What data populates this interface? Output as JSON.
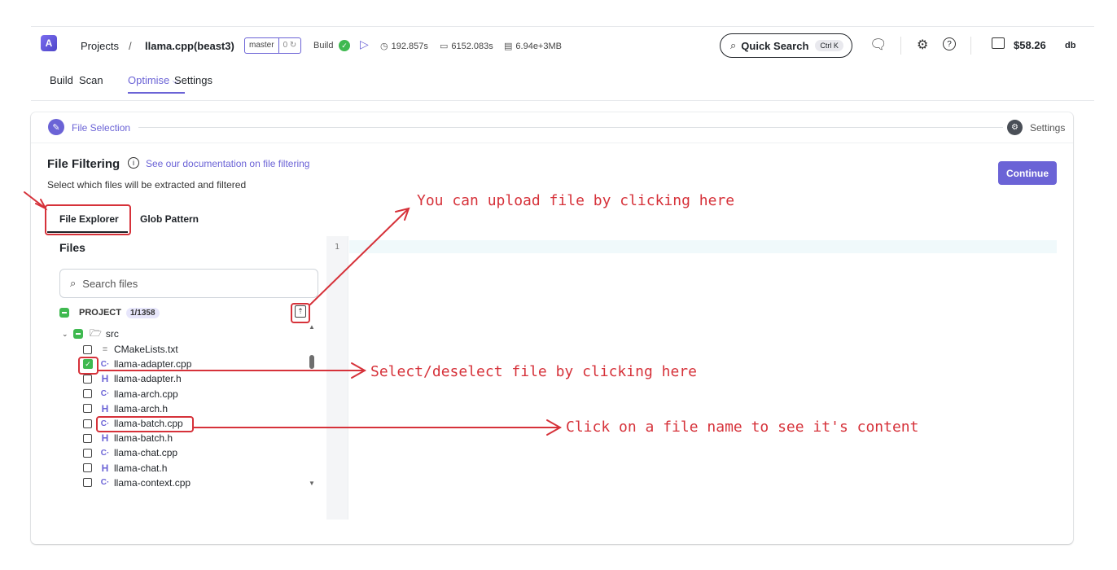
{
  "header": {
    "breadcrumb_projects": "Projects",
    "breadcrumb_sep": "/",
    "project_name": "llama.cpp(beast3)",
    "branch": "master",
    "branch_count": "0 ↻",
    "build_label": "Build",
    "stat_time": "192.857s",
    "stat_cpu": "6152.083s",
    "stat_mem": "6.94e+3MB",
    "quick_search": "Quick Search",
    "quick_search_kbd": "Ctrl K",
    "balance": "$58.26",
    "user": "db"
  },
  "nav": {
    "build": "Build",
    "scan": "Scan",
    "optimise": "Optimise",
    "settings": "Settings"
  },
  "stepper": {
    "step1": "File Selection",
    "step2": "Settings"
  },
  "filtering": {
    "title": "File Filtering",
    "doc_link": "See our documentation on file filtering",
    "subtitle": "Select which files will be extracted and filtered",
    "continue": "Continue",
    "tabs": [
      "File Explorer",
      "Glob Pattern"
    ]
  },
  "files": {
    "heading": "Files",
    "search_placeholder": "Search files",
    "project_label": "PROJECT",
    "project_count": "1/1358",
    "folder": "src",
    "items": [
      {
        "name": "CMakeLists.txt",
        "icon": "text",
        "checked": false
      },
      {
        "name": "llama-adapter.cpp",
        "icon": "cpp",
        "checked": true
      },
      {
        "name": "llama-adapter.h",
        "icon": "h",
        "checked": false
      },
      {
        "name": "llama-arch.cpp",
        "icon": "cpp",
        "checked": false
      },
      {
        "name": "llama-arch.h",
        "icon": "h",
        "checked": false
      },
      {
        "name": "llama-batch.cpp",
        "icon": "cpp",
        "checked": false
      },
      {
        "name": "llama-batch.h",
        "icon": "h",
        "checked": false
      },
      {
        "name": "llama-chat.cpp",
        "icon": "cpp",
        "checked": false
      },
      {
        "name": "llama-chat.h",
        "icon": "h",
        "checked": false
      },
      {
        "name": "llama-context.cpp",
        "icon": "cpp",
        "checked": false
      }
    ]
  },
  "editor": {
    "line_number": "1"
  },
  "annotations": {
    "upload": "You can upload file by clicking here",
    "select": "Select/deselect file by clicking here",
    "view": "Click on a file name to see it's content"
  },
  "colors": {
    "accent": "#6b63d6",
    "success": "#3fb950",
    "annotation": "#d6323a"
  }
}
